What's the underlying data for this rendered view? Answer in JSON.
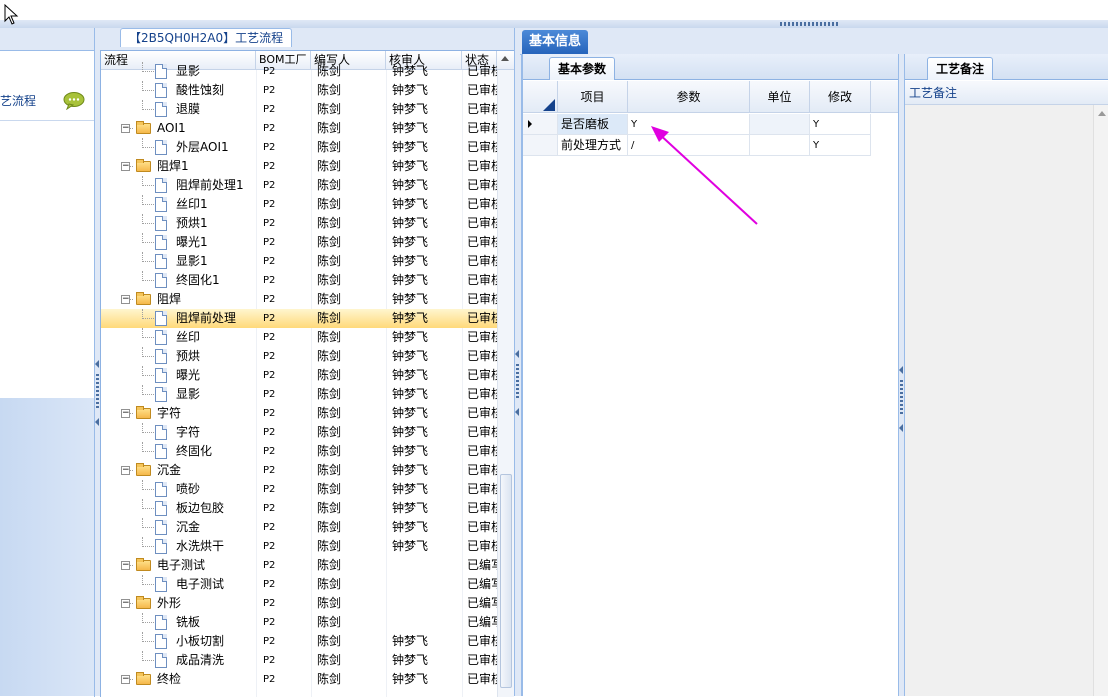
{
  "left_panel": {
    "title": "艺流程",
    "icon": "comment-bubble-icon"
  },
  "tree_panel": {
    "tab_label": "【2B5QH0H2A0】工艺流程",
    "columns": [
      "流程",
      "BOM工厂",
      "编写人",
      "核审人",
      "状态"
    ],
    "rows": [
      {
        "level": 2,
        "type": "doc",
        "name": "显影",
        "bom": "P2",
        "writer": "陈剑",
        "reviewer": "钟梦飞",
        "status": "已审核"
      },
      {
        "level": 2,
        "type": "doc",
        "name": "酸性蚀刻",
        "bom": "P2",
        "writer": "陈剑",
        "reviewer": "钟梦飞",
        "status": "已审核"
      },
      {
        "level": 2,
        "type": "doc",
        "name": "退膜",
        "bom": "P2",
        "writer": "陈剑",
        "reviewer": "钟梦飞",
        "status": "已审核"
      },
      {
        "level": 1,
        "type": "folder",
        "name": "AOI1",
        "bom": "P2",
        "writer": "陈剑",
        "reviewer": "钟梦飞",
        "status": "已审核"
      },
      {
        "level": 2,
        "type": "doc",
        "name": "外层AOI1",
        "bom": "P2",
        "writer": "陈剑",
        "reviewer": "钟梦飞",
        "status": "已审核"
      },
      {
        "level": 1,
        "type": "folder",
        "name": "阻焊1",
        "bom": "P2",
        "writer": "陈剑",
        "reviewer": "钟梦飞",
        "status": "已审核"
      },
      {
        "level": 2,
        "type": "doc",
        "name": "阻焊前处理1",
        "bom": "P2",
        "writer": "陈剑",
        "reviewer": "钟梦飞",
        "status": "已审核"
      },
      {
        "level": 2,
        "type": "doc",
        "name": "丝印1",
        "bom": "P2",
        "writer": "陈剑",
        "reviewer": "钟梦飞",
        "status": "已审核"
      },
      {
        "level": 2,
        "type": "doc",
        "name": "预烘1",
        "bom": "P2",
        "writer": "陈剑",
        "reviewer": "钟梦飞",
        "status": "已审核"
      },
      {
        "level": 2,
        "type": "doc",
        "name": "曝光1",
        "bom": "P2",
        "writer": "陈剑",
        "reviewer": "钟梦飞",
        "status": "已审核"
      },
      {
        "level": 2,
        "type": "doc",
        "name": "显影1",
        "bom": "P2",
        "writer": "陈剑",
        "reviewer": "钟梦飞",
        "status": "已审核"
      },
      {
        "level": 2,
        "type": "doc",
        "name": "终固化1",
        "bom": "P2",
        "writer": "陈剑",
        "reviewer": "钟梦飞",
        "status": "已审核"
      },
      {
        "level": 1,
        "type": "folder",
        "name": "阻焊",
        "bom": "P2",
        "writer": "陈剑",
        "reviewer": "钟梦飞",
        "status": "已审核"
      },
      {
        "level": 2,
        "type": "doc",
        "name": "阻焊前处理",
        "bom": "P2",
        "writer": "陈剑",
        "reviewer": "钟梦飞",
        "status": "已审核",
        "selected": true
      },
      {
        "level": 2,
        "type": "doc",
        "name": "丝印",
        "bom": "P2",
        "writer": "陈剑",
        "reviewer": "钟梦飞",
        "status": "已审核"
      },
      {
        "level": 2,
        "type": "doc",
        "name": "预烘",
        "bom": "P2",
        "writer": "陈剑",
        "reviewer": "钟梦飞",
        "status": "已审核"
      },
      {
        "level": 2,
        "type": "doc",
        "name": "曝光",
        "bom": "P2",
        "writer": "陈剑",
        "reviewer": "钟梦飞",
        "status": "已审核"
      },
      {
        "level": 2,
        "type": "doc",
        "name": "显影",
        "bom": "P2",
        "writer": "陈剑",
        "reviewer": "钟梦飞",
        "status": "已审核"
      },
      {
        "level": 1,
        "type": "folder",
        "name": "字符",
        "bom": "P2",
        "writer": "陈剑",
        "reviewer": "钟梦飞",
        "status": "已审核"
      },
      {
        "level": 2,
        "type": "doc",
        "name": "字符",
        "bom": "P2",
        "writer": "陈剑",
        "reviewer": "钟梦飞",
        "status": "已审核"
      },
      {
        "level": 2,
        "type": "doc",
        "name": "终固化",
        "bom": "P2",
        "writer": "陈剑",
        "reviewer": "钟梦飞",
        "status": "已审核"
      },
      {
        "level": 1,
        "type": "folder",
        "name": "沉金",
        "bom": "P2",
        "writer": "陈剑",
        "reviewer": "钟梦飞",
        "status": "已审核"
      },
      {
        "level": 2,
        "type": "doc",
        "name": "喷砂",
        "bom": "P2",
        "writer": "陈剑",
        "reviewer": "钟梦飞",
        "status": "已审核"
      },
      {
        "level": 2,
        "type": "doc",
        "name": "板边包胶",
        "bom": "P2",
        "writer": "陈剑",
        "reviewer": "钟梦飞",
        "status": "已审核"
      },
      {
        "level": 2,
        "type": "doc",
        "name": "沉金",
        "bom": "P2",
        "writer": "陈剑",
        "reviewer": "钟梦飞",
        "status": "已审核"
      },
      {
        "level": 2,
        "type": "doc",
        "name": "水洗烘干",
        "bom": "P2",
        "writer": "陈剑",
        "reviewer": "钟梦飞",
        "status": "已审核"
      },
      {
        "level": 1,
        "type": "folder",
        "name": "电子测试",
        "bom": "P2",
        "writer": "陈剑",
        "reviewer": "",
        "status": "已编写"
      },
      {
        "level": 2,
        "type": "doc",
        "name": "电子测试",
        "bom": "P2",
        "writer": "陈剑",
        "reviewer": "",
        "status": "已编写"
      },
      {
        "level": 1,
        "type": "folder",
        "name": "外形",
        "bom": "P2",
        "writer": "陈剑",
        "reviewer": "",
        "status": "已编写"
      },
      {
        "level": 2,
        "type": "doc",
        "name": "铣板",
        "bom": "P2",
        "writer": "陈剑",
        "reviewer": "",
        "status": "已编写"
      },
      {
        "level": 2,
        "type": "doc",
        "name": "小板切割",
        "bom": "P2",
        "writer": "陈剑",
        "reviewer": "钟梦飞",
        "status": "已审核"
      },
      {
        "level": 2,
        "type": "doc",
        "name": "成品清洗",
        "bom": "P2",
        "writer": "陈剑",
        "reviewer": "钟梦飞",
        "status": "已审核"
      },
      {
        "level": 1,
        "type": "folder",
        "name": "终检",
        "bom": "P2",
        "writer": "陈剑",
        "reviewer": "钟梦飞",
        "status": "已审核"
      }
    ]
  },
  "info_panel": {
    "tab_label": "基本信息",
    "sub_tab_label": "基本参数",
    "columns": [
      "项目",
      "参数",
      "单位",
      "修改"
    ],
    "rows": [
      {
        "item": "是否磨板",
        "param": "Y",
        "unit": "",
        "modify": "Y",
        "current": true
      },
      {
        "item": "前处理方式",
        "param": "/",
        "unit": "",
        "modify": "Y"
      }
    ]
  },
  "notes_panel": {
    "tab_label": "工艺备注",
    "column": "工艺备注"
  },
  "colors": {
    "accent_tab": "#2f6fc6",
    "selected_row": "#ffd97a",
    "annotation_arrow": "#e000e0"
  }
}
